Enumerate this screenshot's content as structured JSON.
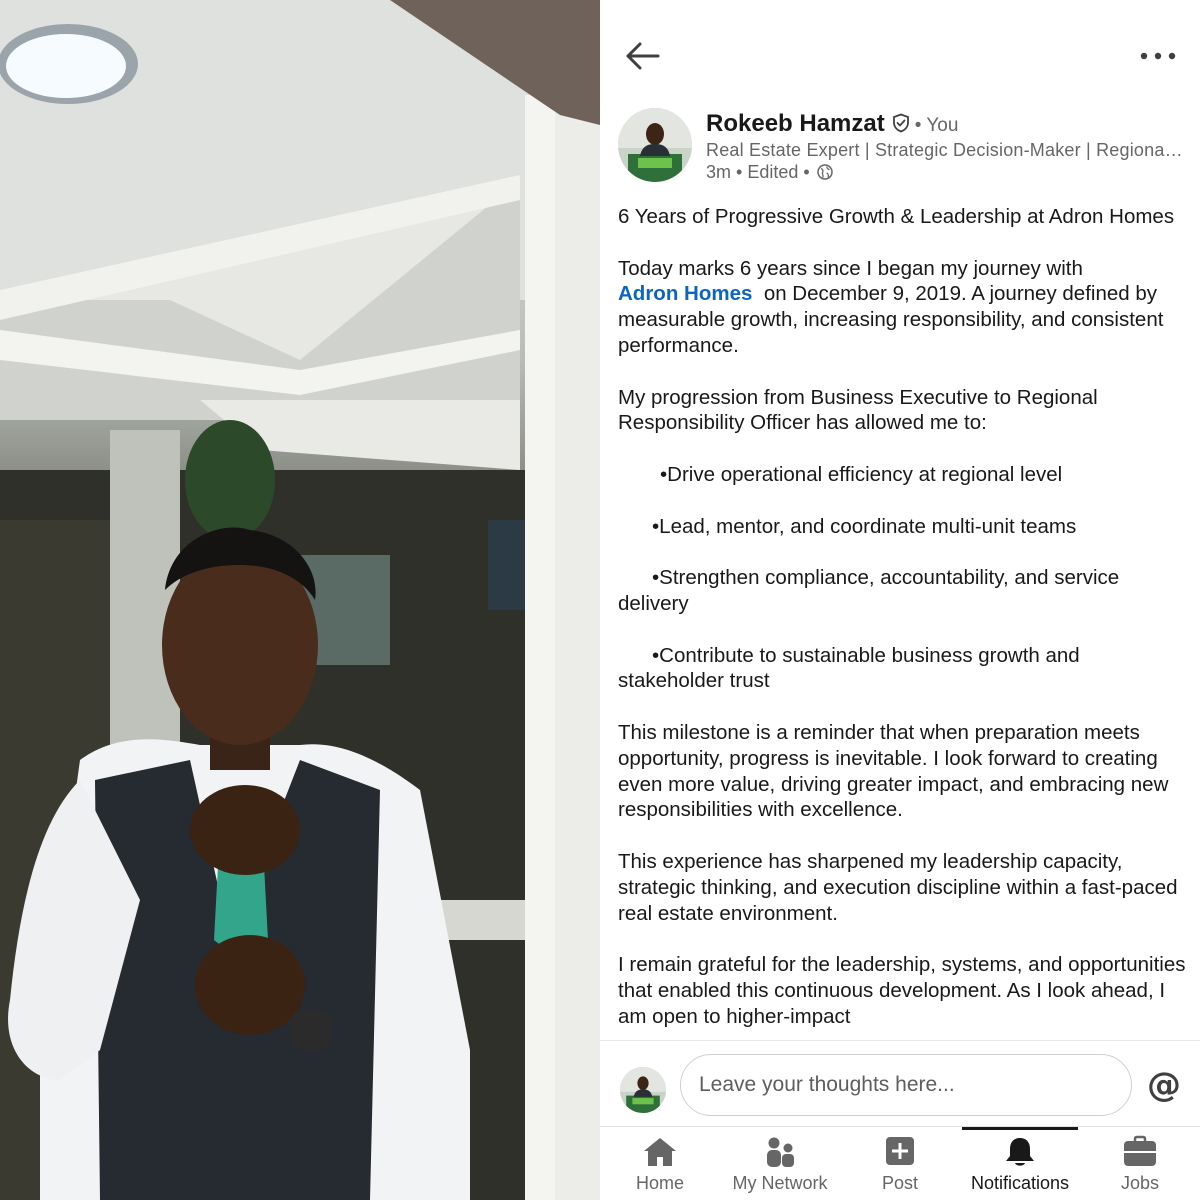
{
  "author": {
    "name": "Rokeeb Hamzat",
    "you": "• You",
    "headline": "Real Estate Expert | Strategic Decision-Maker | Regional Responsibility Officer",
    "time": "3m",
    "edited": "• Edited •"
  },
  "post": {
    "title": "6 Years of Progressive Growth & Leadership at Adron Homes",
    "intro_before": "Today marks 6 years since I began my journey with",
    "mention": "Adron Homes",
    "intro_after": "on December 9, 2019. A journey defined by measurable growth, increasing responsibility, and consistent performance.",
    "progression": "My progression from Business Executive to Regional Responsibility Officer has allowed me to:",
    "bullets": [
      "•Drive operational efficiency at regional level",
      "•Lead, mentor, and coordinate multi-unit teams",
      "•Strengthen compliance, accountability, and service delivery",
      "•Contribute to sustainable business growth and stakeholder trust"
    ],
    "milestone": "This milestone is a reminder that when preparation meets opportunity, progress is inevitable. I look forward to creating even more value, driving greater impact, and embracing new responsibilities with excellence.",
    "experience": "This experience has sharpened my leadership capacity, strategic thinking, and execution discipline within a fast-paced real estate environment.",
    "grateful": "I remain grateful for the leadership, systems, and opportunities that enabled this continuous development. As I look ahead, I am open to higher-impact"
  },
  "comment": {
    "placeholder": "Leave your thoughts here...",
    "at_label": "@"
  },
  "nav": {
    "home": "Home",
    "network": "My Network",
    "post": "Post",
    "notifications": "Notifications",
    "jobs": "Jobs",
    "active": "notifications"
  },
  "colors": {
    "link": "#0a66c2",
    "text": "#191919",
    "muted": "#666666"
  }
}
